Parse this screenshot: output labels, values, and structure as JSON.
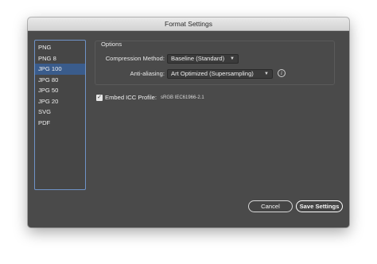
{
  "window": {
    "title": "Format Settings"
  },
  "formats": {
    "items": [
      "PNG",
      "PNG 8",
      "JPG 100",
      "JPG 80",
      "JPG 50",
      "JPG 20",
      "SVG",
      "PDF"
    ],
    "selected": "JPG 100"
  },
  "options": {
    "title": "Options",
    "compression_label": "Compression Method:",
    "compression_value": "Baseline (Standard)",
    "antialiasing_label": "Anti-aliasing:",
    "antialiasing_value": "Art Optimized (Supersampling)"
  },
  "icc": {
    "checked": true,
    "label": "Embed ICC Profile:",
    "value": "sRGB IEC61966-2.1"
  },
  "buttons": {
    "cancel": "Cancel",
    "save": "Save Settings"
  },
  "icons": {
    "dropdown": "chevron-down-icon",
    "info": "info-icon",
    "check": "checkmark-icon"
  }
}
